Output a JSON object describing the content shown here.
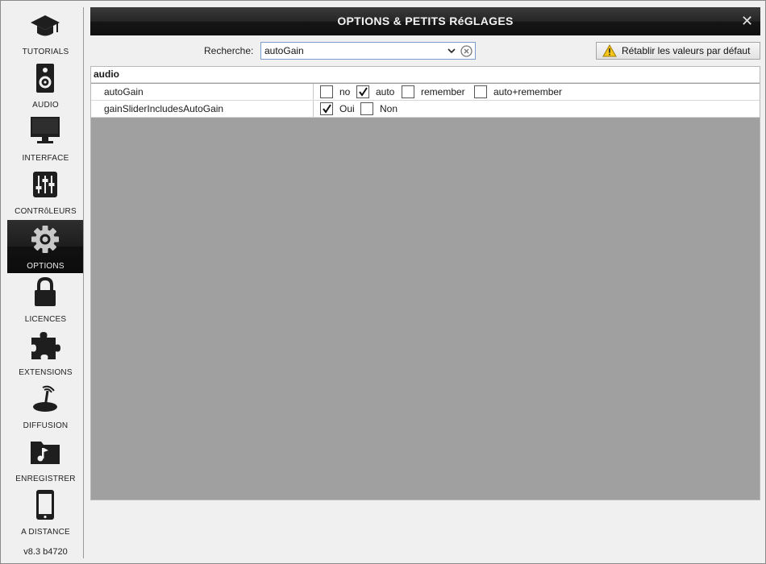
{
  "window": {
    "title": "OPTIONS & PETITS RéGLAGES",
    "close_glyph": "✕"
  },
  "sidebar": {
    "items": [
      {
        "label": "TUTORIALS",
        "icon": "graduation-cap-icon"
      },
      {
        "label": "AUDIO",
        "icon": "speaker-icon"
      },
      {
        "label": "INTERFACE",
        "icon": "monitor-icon"
      },
      {
        "label": "CONTRôLEURS",
        "icon": "mixer-sliders-icon"
      },
      {
        "label": "OPTIONS",
        "icon": "gear-icon",
        "active": true
      },
      {
        "label": "LICENCES",
        "icon": "lock-icon"
      },
      {
        "label": "EXTENSIONS",
        "icon": "puzzle-icon"
      },
      {
        "label": "DIFFUSION",
        "icon": "broadcast-dish-icon"
      },
      {
        "label": "ENREGISTRER",
        "icon": "music-folder-icon"
      },
      {
        "label": "A DISTANCE",
        "icon": "tablet-icon"
      }
    ],
    "version": "v8.3 b4720"
  },
  "search": {
    "label": "Recherche:",
    "value": "autoGain"
  },
  "reset_button": {
    "label": "Rétablir les valeurs par défaut",
    "icon": "warning-icon"
  },
  "table": {
    "section": "audio",
    "rows": [
      {
        "name": "autoGain",
        "options": [
          {
            "label": "no",
            "checked": false
          },
          {
            "label": "auto",
            "checked": true
          },
          {
            "label": "remember",
            "checked": false
          },
          {
            "label": "auto+remember",
            "checked": false
          }
        ]
      },
      {
        "name": "gainSliderIncludesAutoGain",
        "options": [
          {
            "label": "Oui",
            "checked": true
          },
          {
            "label": "Non",
            "checked": false
          }
        ]
      }
    ]
  },
  "colors": {
    "panel_background": "#a0a0a0",
    "titlebar": "#1a1a1a",
    "active_nav": "#151515"
  }
}
